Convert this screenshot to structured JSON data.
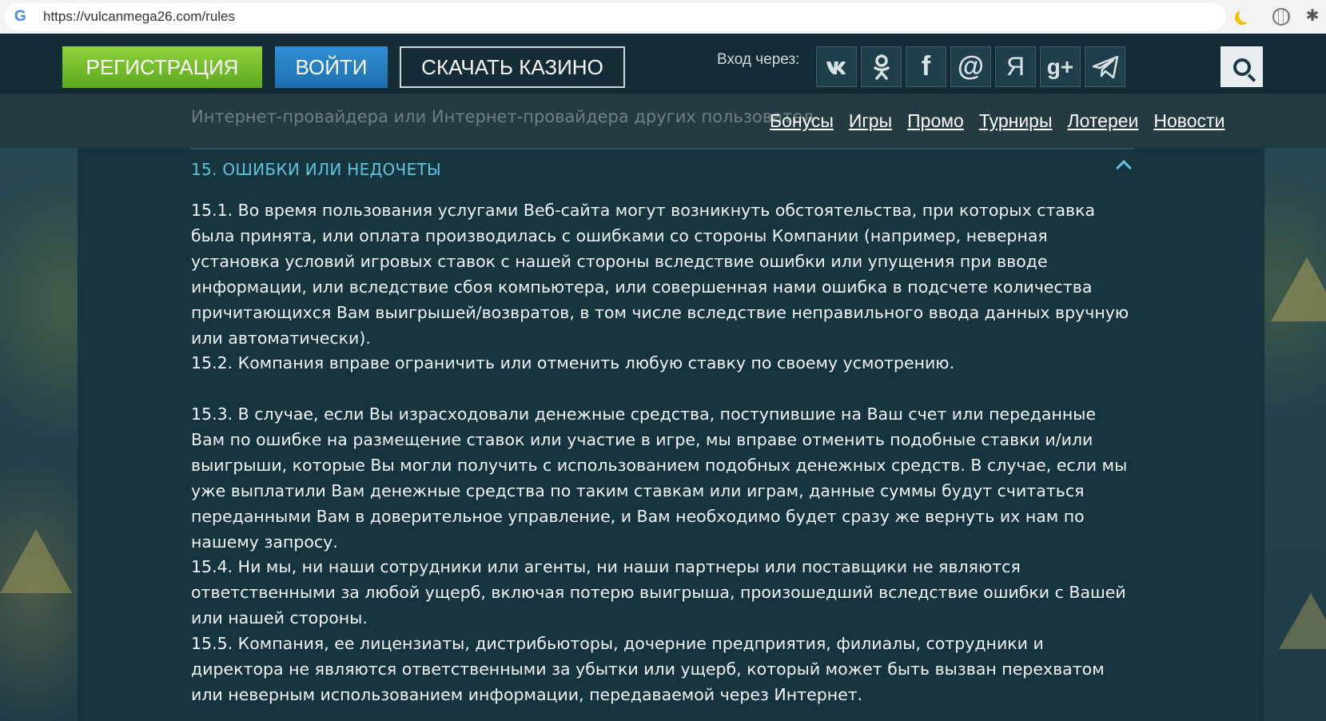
{
  "browser": {
    "url": "https://vulcanmega26.com/rules",
    "favicon": "G"
  },
  "header": {
    "register_label": "РЕГИСТРАЦИЯ",
    "login_label": "ВОЙТИ",
    "download_label": "СКАЧАТЬ КАЗИНО",
    "login_via_label": "Вход через:",
    "social": [
      {
        "icon": "vk-icon",
        "glyph": "vk"
      },
      {
        "icon": "odnoklassniki-icon",
        "glyph": "ok"
      },
      {
        "icon": "facebook-icon",
        "glyph": "f"
      },
      {
        "icon": "mail-ru-icon",
        "glyph": "@"
      },
      {
        "icon": "yandex-icon",
        "glyph": "Я"
      },
      {
        "icon": "google-plus-icon",
        "glyph": "g+"
      },
      {
        "icon": "telegram-icon",
        "glyph": "➤"
      }
    ],
    "search_icon": "search-icon"
  },
  "nav": {
    "links": [
      "Бонусы",
      "Игры",
      "Промо",
      "Турниры",
      "Лотереи",
      "Новости"
    ]
  },
  "article": {
    "partial_text_line": "Интернет-провайдера или Интернет-провайдера других пользовател",
    "section_title": "15. ОШИБКИ ИЛИ НЕДОЧЕТЫ",
    "paragraphs": [
      "15.1. Во время пользования услугами Веб-сайта могут возникнуть обстоятельства, при которых ставка была принята, или оплата производилась с ошибками со стороны Компании (например, неверная установка условий игровых ставок с нашей стороны вследствие ошибки или упущения при вводе информации, или вследствие сбоя компьютера, или совершенная нами ошибка в подсчете количества причитающихся Вам выигрышей/возвратов, в том числе вследствие неправильного ввода данных вручную или автоматически).",
      "15.2. Компания вправе ограничить или отменить любую ставку по своему усмотрению.",
      "15.3. В случае, если Вы израсходовали денежные средства, поступившие на Ваш счет или переданные Вам по ошибке на размещение ставок или участие в игре, мы вправе отменить подобные ставки и/или выигрыши, которые Вы могли получить с использованием подобных денежных средств. В случае, если мы уже выплатили Вам денежные средства по таким ставкам или играм, данные суммы будут считаться переданными Вам в доверительное управление, и Вам необходимо будет сразу же вернуть их нам по нашему запросу.",
      "15.4. Ни мы, ни наши сотрудники или агенты, ни наши партнеры или поставщики не являются ответственными за любой ущерб, включая потерю выигрыша, произошедший вследствие ошибки с Вашей или нашей стороны.",
      "15.5. Компания, ее лицензиаты, дистрибьюторы, дочерние предприятия, филиалы, сотрудники и директора не являются ответственными за убытки или ущерб, который может быть вызван перехватом или неверным использованием информации, передаваемой через Интернет."
    ]
  },
  "colors": {
    "register": "#7cc233",
    "login": "#2580c3",
    "accent": "#5fc3dc",
    "header_bg": "#142c36"
  }
}
